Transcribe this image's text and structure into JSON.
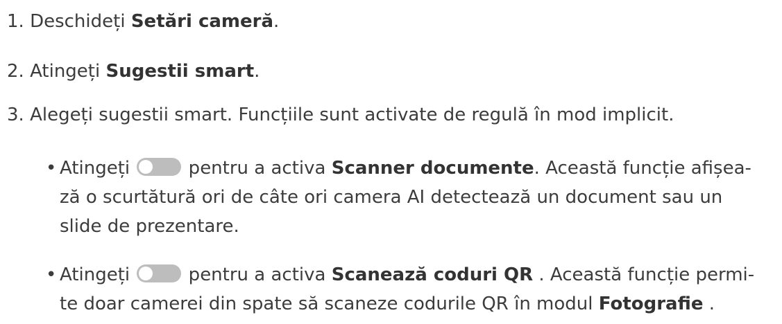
{
  "steps": [
    {
      "num": "1.",
      "pre": "Deschideți ",
      "bold": "Setări cameră",
      "post": "."
    },
    {
      "num": "2.",
      "pre": "Atingeți ",
      "bold": "Sugestii smart",
      "post": "."
    },
    {
      "num": "3.",
      "text": "Alegeți sugestii smart. Funcțiile sunt activate de regulă în mod implicit."
    }
  ],
  "bullets": [
    {
      "marker": "•",
      "pre": "Atingeți",
      "mid": " pentru a activa ",
      "bold": "Scanner documente",
      "line1_post": ". Această funcție afișea-",
      "line2": "ză o scurtătură ori de câte ori camera AI detectează un document sau un",
      "line3": "slide de prezentare."
    },
    {
      "marker": "•",
      "pre": "Atingeți",
      "mid": " pentru a activa ",
      "bold": "Scanează coduri QR",
      "line1_post": " . Această funcție permi-",
      "line2_pre": "te doar camerei din spate să scaneze codurile QR în modul ",
      "line2_bold": "Fotografie",
      "line2_post": " ."
    }
  ],
  "toggle_icon": "toggle-off-icon",
  "colors": {
    "text": "#3c3c3c",
    "toggle": "#bdbdbd"
  }
}
